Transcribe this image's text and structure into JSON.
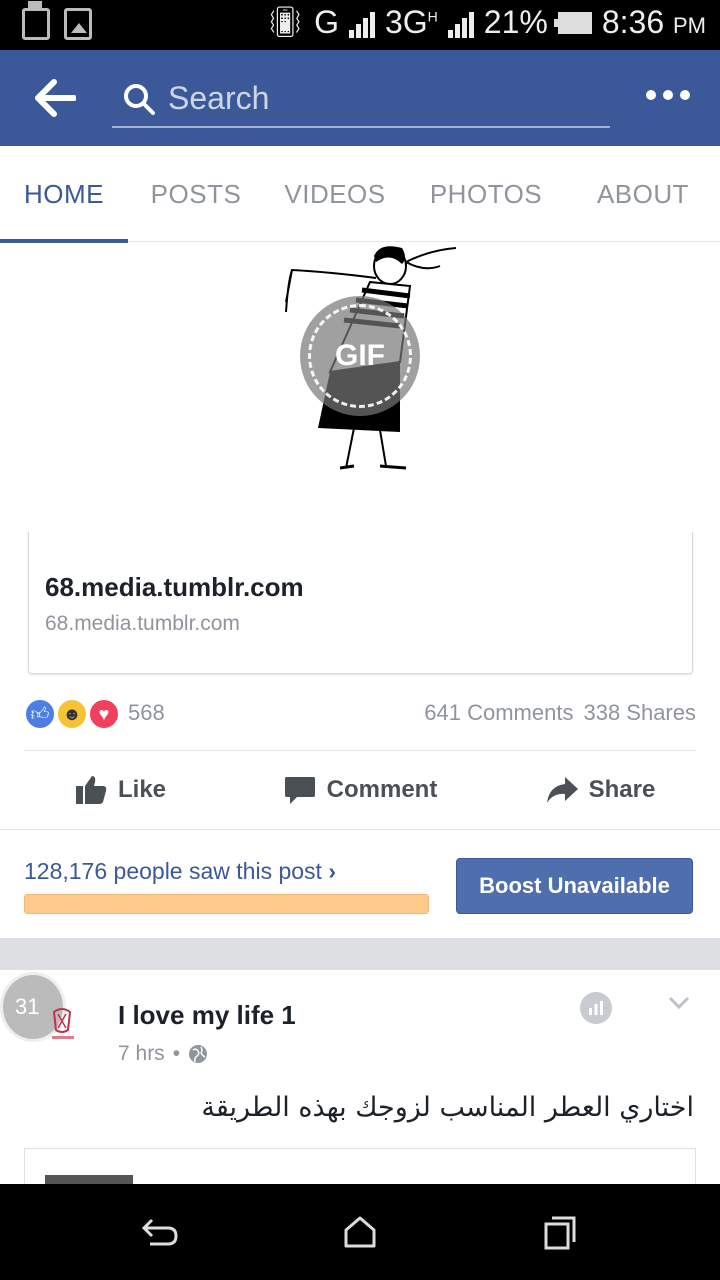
{
  "status_bar": {
    "network_type_1": "G",
    "network_type_2": "3G",
    "network_superscript": "H",
    "battery": "21%",
    "time": "8:36",
    "ampm": "PM"
  },
  "app_bar": {
    "search_placeholder": "Search",
    "color": "#3b5998"
  },
  "tabs": [
    {
      "label": "HOME",
      "active": true
    },
    {
      "label": "POSTS",
      "active": false
    },
    {
      "label": "VIDEOS",
      "active": false
    },
    {
      "label": "PHOTOS",
      "active": false
    },
    {
      "label": "ABOUT",
      "active": false
    }
  ],
  "gif": {
    "badge": "GIF"
  },
  "link_card": {
    "title": "68.media.tumblr.com",
    "domain": "68.media.tumblr.com"
  },
  "reactions": {
    "count": "568",
    "comments": "641 Comments",
    "shares": "338 Shares"
  },
  "actions": {
    "like": "Like",
    "comment": "Comment",
    "share": "Share"
  },
  "insights": {
    "reach_text": "128,176 people saw this post",
    "chevron": "›",
    "boost_label": "Boost Unavailable",
    "progress": 1.0,
    "progress_color": "#ffc98a"
  },
  "next_post": {
    "avatar_text": "31",
    "author": "I love my life 1",
    "time": "7 hrs",
    "separator": "•",
    "text": "اختاري العطر المناسب لزوجك بهذه الطريقة"
  }
}
